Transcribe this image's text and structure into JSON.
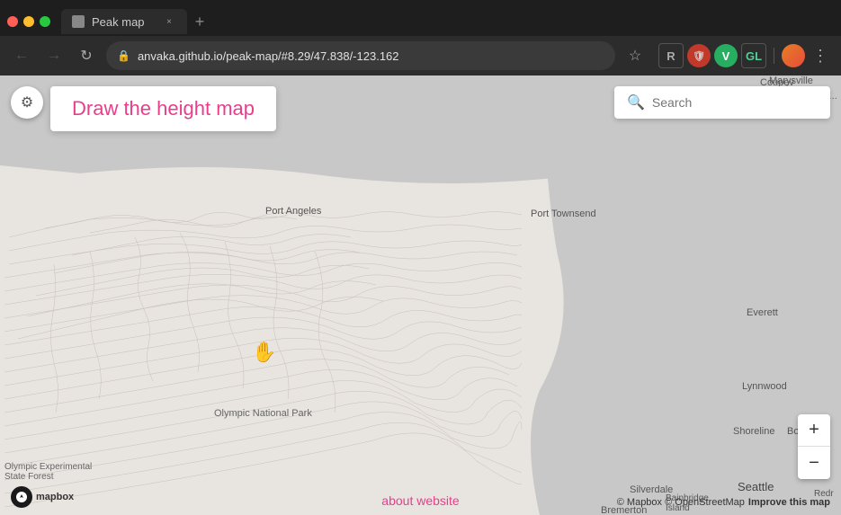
{
  "browser": {
    "tab_title": "Peak map",
    "url": "anvaka.github.io/peak-map/#8.29/47.838/-123.162",
    "new_tab_symbol": "+",
    "back_disabled": false,
    "forward_disabled": false
  },
  "toolbar": {
    "search_placeholder": "Search"
  },
  "map": {
    "draw_prompt": "Draw the height map",
    "about_link": "about website",
    "attribution": "© Mapbox © OpenStreetMap",
    "improve_label": "Improve this map",
    "zoom_in": "+",
    "zoom_out": "−",
    "place_labels": [
      "Port Angeles",
      "Port Townsend",
      "Marysville",
      "Everett",
      "Lynnwood",
      "Shoreline",
      "Bothell",
      "Silverdale",
      "Bainbridge Island",
      "Bremerton",
      "Seattle",
      "Olympic National Park",
      "Olympic Experimental State Forest",
      "Coupev",
      "Redr"
    ],
    "cursor_symbol": "✋"
  },
  "icons": {
    "settings": "⚙",
    "search": "🔍",
    "lock": "🔒",
    "star": "☆",
    "back": "←",
    "forward": "→",
    "reload": "↻",
    "close": "×"
  }
}
